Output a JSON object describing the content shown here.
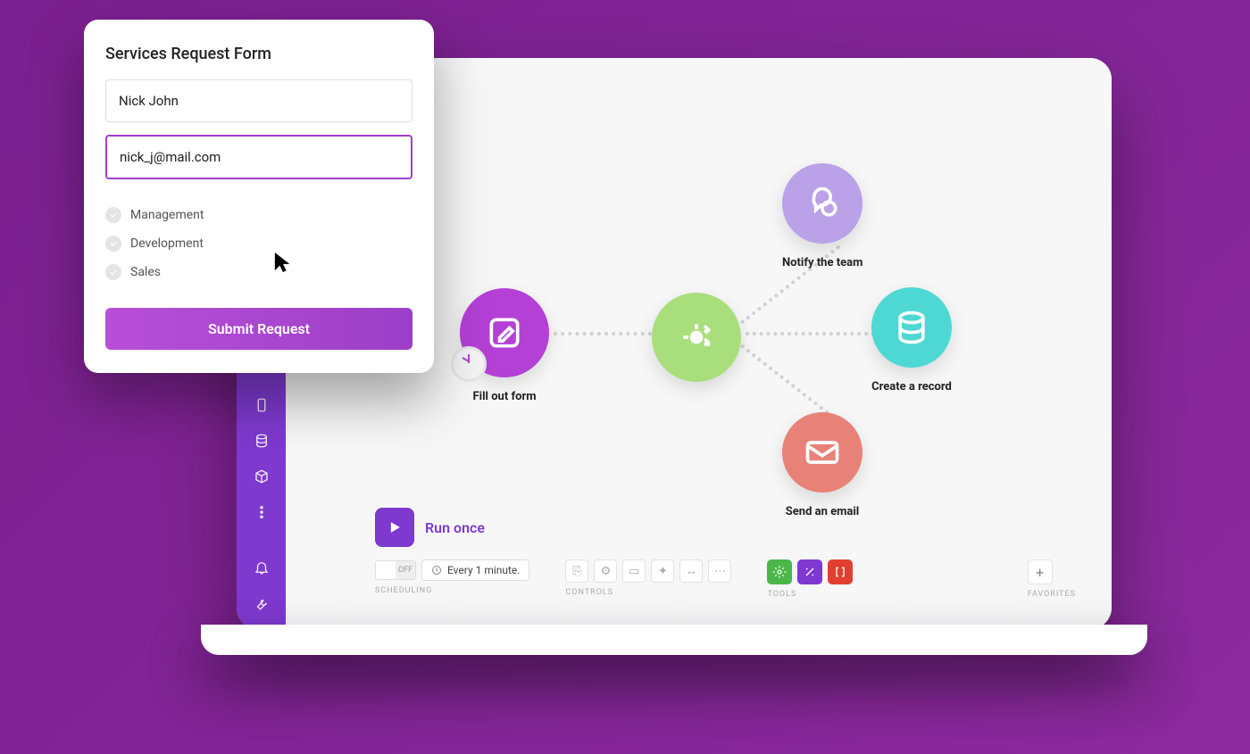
{
  "form": {
    "title": "Services Request Form",
    "name_value": "Nick John",
    "email_value": "nick_j@mail.com",
    "options": [
      "Management",
      "Development",
      "Sales"
    ],
    "submit_label": "Submit Request"
  },
  "flow": {
    "fill_out": "Fill out form",
    "notify": "Notify the team",
    "record": "Create a record",
    "email": "Send an email"
  },
  "runbar": {
    "run_label": "Run once"
  },
  "bottom": {
    "toggle_off": "OFF",
    "schedule_text": "Every 1 minute.",
    "scheduling_label": "SCHEDULING",
    "controls_label": "CONTROLS",
    "tools_label": "TOOLS",
    "favorites_label": "FAVORITES"
  }
}
